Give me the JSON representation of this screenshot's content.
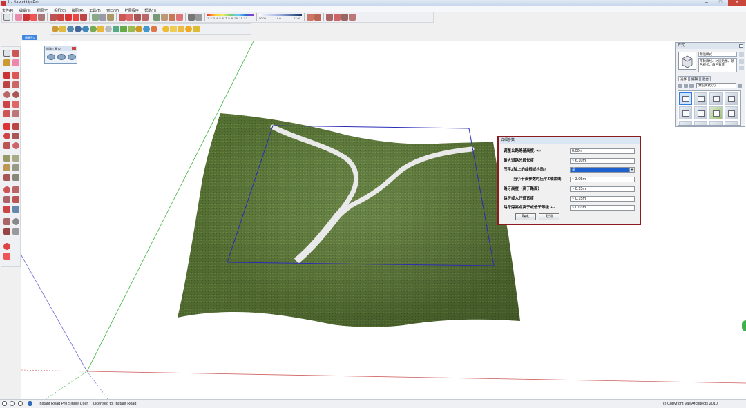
{
  "window": {
    "title": "1 - SketchUp Pro",
    "controls": {
      "minimize": "–",
      "maximize": "□",
      "close": "✕"
    }
  },
  "menu": [
    "文件(F)",
    "编辑(E)",
    "视图(V)",
    "相机(C)",
    "绘图(R)",
    "工具(T)",
    "窗口(W)",
    "扩展程序",
    "帮助(H)"
  ],
  "toolbar": {
    "color_scale_numbers": "1 2 3 4 5 6 7 8 9 10 11 12",
    "gradient_scale": {
      "min": "00.00",
      "mid": "0.0",
      "max": "17.00"
    }
  },
  "scene_tab": "场景号1",
  "floating_toolbar": {
    "title": "道路工具 (2)"
  },
  "dialog": {
    "title": "详细参数",
    "fields": [
      {
        "label": "调整公路路基高度: +/-",
        "value": "0.00m"
      },
      {
        "label": "最大道路分段长度",
        "value": "~ 6.10m"
      },
      {
        "label": "压平Z轴上的曲线或抖动?",
        "value": "是"
      },
      {
        "label": "当小于该参数时压平Z轴曲线",
        "value": "~ 3.05m"
      },
      {
        "label": "路牙高度（高于路面）",
        "value": "~ 0.15m"
      },
      {
        "label": "路牙或人行道宽度",
        "value": "~ 0.15m"
      },
      {
        "label": "路牙旁高点高于或低于等级 +/-",
        "value": "~ 0.03m"
      }
    ],
    "ok_label": "确定",
    "cancel_label": "取消"
  },
  "styles_tray": {
    "title": "样式",
    "style_name": "预设样式",
    "style_description": "带轮廓线、材质贴图、颜色模式、白色背景",
    "tabs": [
      "选择",
      "编辑",
      "混合"
    ],
    "collection": "预设样式 (1)",
    "swatch_count": 12
  },
  "statusbar": {
    "product": "Instant Road Pro  Single User",
    "license": "Licensed to: Instant Road",
    "copyright": "(c) Copyright   Vali Architects 2010"
  },
  "colors": {
    "terrain": "#5f7a35",
    "road": "#e8e8e8",
    "selection": "#2b2bb8",
    "dialog_border": "#8c1a1f",
    "accent": "#3f86e0"
  }
}
